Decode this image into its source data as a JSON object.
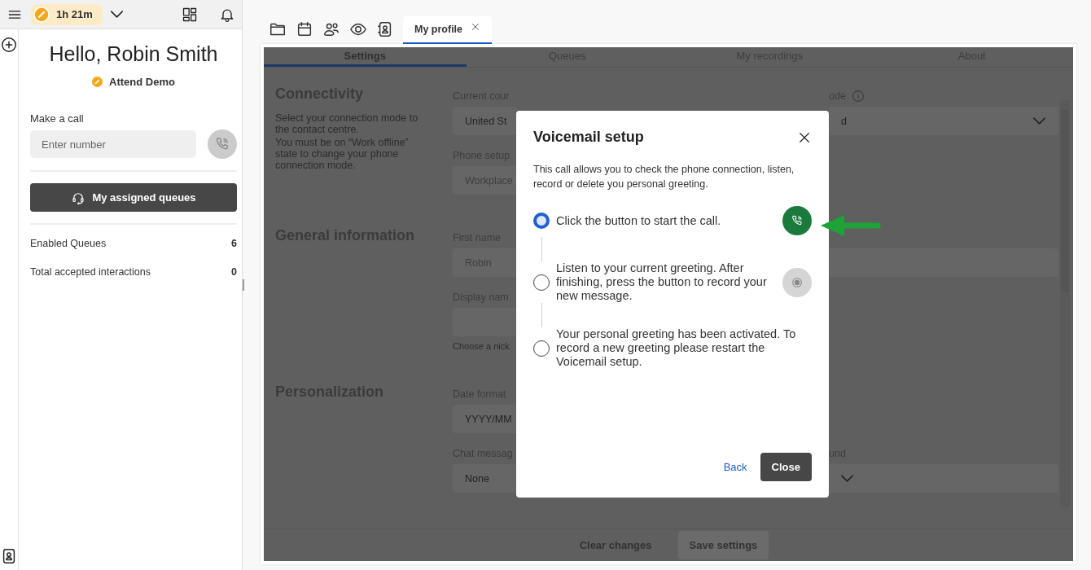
{
  "topbar": {
    "timer": "1h 21m"
  },
  "greeting": "Hello, Robin Smith",
  "presence": {
    "label": "Attend Demo"
  },
  "make_call": {
    "label": "Make a call",
    "placeholder": "Enter number"
  },
  "queues_button": {
    "label": "My assigned queues"
  },
  "stats": [
    {
      "label": "Enabled Queues",
      "value": "6"
    },
    {
      "label": "Total accepted interactions",
      "value": "0"
    }
  ],
  "workspace_tabs": [
    {
      "label": "My profile",
      "selected": true,
      "closable": true
    }
  ],
  "settings": {
    "tabs": [
      {
        "label": "Settings",
        "selected": true
      },
      {
        "label": "Queues",
        "selected": false
      },
      {
        "label": "My recordings",
        "selected": false
      },
      {
        "label": "About",
        "selected": false
      }
    ],
    "sections": [
      {
        "title": "Connectivity",
        "description": [
          "Select your connection mode to the contact centre.",
          "You must be on “Work offline” state to change your phone connection mode."
        ],
        "rows": [
          {
            "left": {
              "label": "Current cour",
              "value": "United St",
              "disabled": false
            },
            "right": {
              "label": "ode",
              "info": true,
              "value": "d",
              "dropdown": true
            }
          },
          {
            "left": {
              "label": "Phone setup",
              "value": "Workplace",
              "disabled": true
            }
          }
        ]
      },
      {
        "title": "General information",
        "rows": [
          {
            "left": {
              "label": "First name",
              "value": "Robin",
              "disabled": true
            },
            "right": {
              "dropdown": false
            }
          },
          {
            "left": {
              "label": "Display nam",
              "hint": "Choose a nick"
            }
          }
        ]
      },
      {
        "title": "Personalization",
        "rows": [
          {
            "left": {
              "label": "Date format",
              "value": "YYYY/MM",
              "disabled": false
            }
          },
          {
            "left": {
              "label": "Chat messag",
              "value": "None",
              "disabled": false
            },
            "right": {
              "label": "und",
              "dropdown": true
            }
          }
        ]
      }
    ],
    "footer": {
      "secondary": "Clear changes",
      "primary": "Save settings"
    }
  },
  "dialog": {
    "title": "Voicemail setup",
    "description": "This call allows you to check the phone connection, listen, record or delete you personal greeting.",
    "steps": [
      {
        "text": "Click the button to start the call.",
        "selected": true,
        "button": {
          "kind": "call",
          "disabled": false
        }
      },
      {
        "text": "Listen to your current greeting. After finishing, press the button to record your new message.",
        "selected": false,
        "button": {
          "kind": "record",
          "disabled": true
        }
      },
      {
        "text": "Your personal greeting has been activated. To record a new greeting please restart the Voicemail setup.",
        "selected": false
      }
    ],
    "back": "Back",
    "close": "Close"
  }
}
